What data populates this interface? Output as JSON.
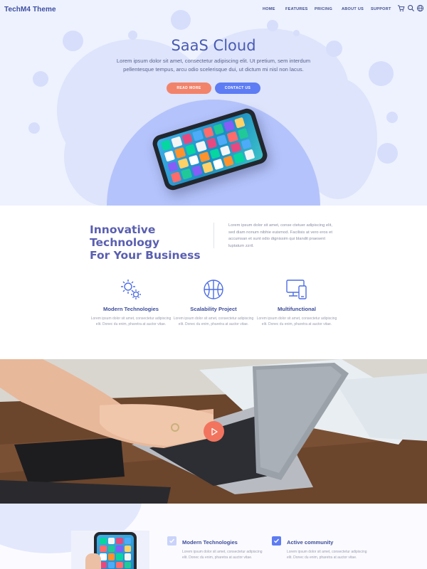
{
  "brand": "TechM4 Theme",
  "nav": {
    "items": [
      "HOME",
      "FEATURES",
      "PRICING",
      "ABOUT US",
      "SUPPORT"
    ],
    "icons": [
      "cart-icon",
      "search-icon",
      "globe-icon"
    ]
  },
  "hero": {
    "title": "SaaS Cloud",
    "text": "Lorem ipsum dolor sit amet, consectetur adipiscing elit. Ut pretium, sem interdum pellentesque tempus, arcu odio scelerisque dui, ut dictum mi nisl non lacus.",
    "read_more": "READ MORE",
    "contact_us": "CONTACT US"
  },
  "intro": {
    "title_line1": "Innovative Technology",
    "title_line2": "For Your Business",
    "text": "Lorem ipsum dolor sit amet, conse ctetuer adipiscing elit, sed diam nonum nibhie euismod. Facilisis at vero eros et accumsan et sunt odio dignissim qui blandit praesent luptatum zzril."
  },
  "features": [
    {
      "title": "Modern Technologies",
      "text": "Lorem ipsum dolor sit amet, consectetur adipiscing elit. Donec du enim, pharetra at auctor vitae."
    },
    {
      "title": "Scalability Project",
      "text": "Lorem ipsum dolor sit amet, consectetur adipiscing elit. Donec du enim, pharetra at auctor vitae."
    },
    {
      "title": "Multifunctional",
      "text": "Lorem ipsum dolor sit amet, consectetur adipiscing elit. Donec du enim, pharetra at auctor vitae."
    }
  ],
  "bottom": [
    {
      "title": "Modern Technologies",
      "text": "Lorem ipsum dolor sit amet, consectetur adipiscing elit. Donec du enim, pharetra at auctor vitae."
    },
    {
      "title": "Active community",
      "text": "Lorem ipsum dolor sit amet, consectetur adipiscing elit. Donec du enim, pharetra at auctor vitae."
    }
  ],
  "colors": {
    "accent_blue": "#5e7cf3",
    "accent_orange": "#f2836b",
    "heading": "#4a5bb3"
  }
}
